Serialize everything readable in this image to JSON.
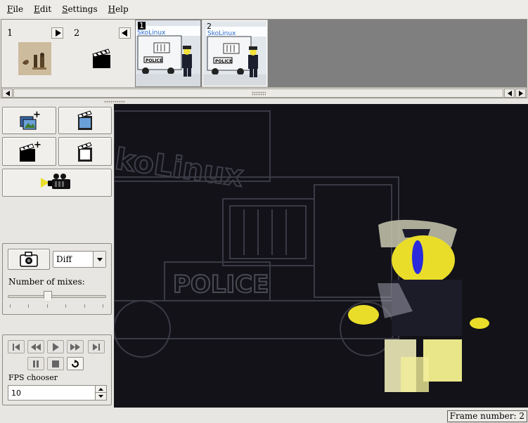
{
  "menu": [
    {
      "label": "File",
      "accel": "F",
      "rest": "ile"
    },
    {
      "label": "Edit",
      "accel": "E",
      "rest": "dit"
    },
    {
      "label": "Settings",
      "accel": "S",
      "rest": "ettings"
    },
    {
      "label": "Help",
      "accel": "H",
      "rest": "elp"
    }
  ],
  "scenes": [
    {
      "number": "1",
      "arrow": "right",
      "thumb": "scene-1-thumbnail"
    },
    {
      "number": "2",
      "arrow": "left",
      "thumb": "clapperboard-icon"
    }
  ],
  "frames": [
    {
      "number": "1",
      "selected": true,
      "image": "police-truck-frame"
    },
    {
      "number": "2",
      "selected": false,
      "image": "police-truck-frame"
    }
  ],
  "tools": {
    "add_frames": "add-frames-icon",
    "remove_frames": "remove-frames-icon",
    "new_scene": "new-scene-icon",
    "remove_scene": "remove-scene-icon",
    "camera": "video-camera-icon"
  },
  "capture": {
    "mix_mode": "Diff",
    "mixes_label": "Number of mixes:",
    "mixes_level_fraction": 0.4
  },
  "playback": {
    "fps_label": "FPS chooser",
    "fps_value": "10"
  },
  "status": {
    "frame_number": "Frame number: 2"
  },
  "colors": {
    "accent_yellow": "#e9dd2a",
    "viewer_bg": "#121218",
    "frame_bg": "#7f7f7f"
  }
}
